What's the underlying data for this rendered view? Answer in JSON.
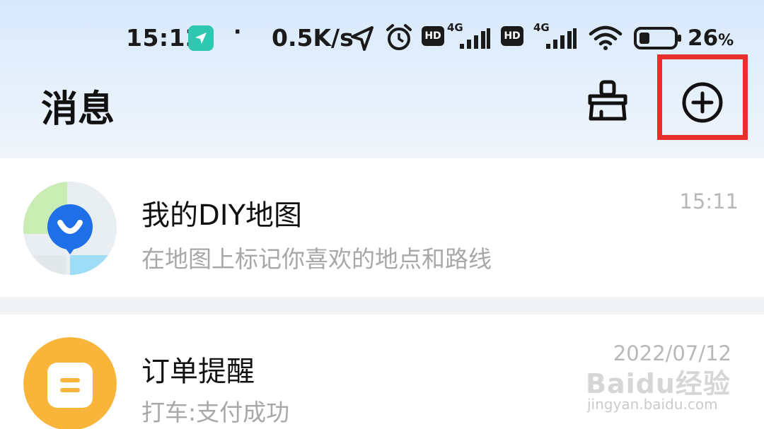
{
  "status_bar": {
    "time": "15:12",
    "dot": "·",
    "net_speed": "0.5K/s",
    "hd_label": "HD",
    "network_label": "4G",
    "battery_value": "26",
    "battery_unit": "%",
    "icons": [
      "navigation-badge-icon",
      "location-arrow-icon",
      "alarm-icon",
      "hd-icon",
      "signal-icon",
      "wifi-icon",
      "battery-icon"
    ]
  },
  "header": {
    "title": "消息",
    "icons": [
      "clean-brush-icon",
      "add-circle-icon"
    ]
  },
  "messages": [
    {
      "title": "我的DIY地图",
      "subtitle": "在地图上标记你喜欢的地点和路线",
      "time": "15:11",
      "avatar_icon": "diy-map-avatar-icon"
    },
    {
      "title": "订单提醒",
      "subtitle": "打车:支付成功",
      "time": "2022/07/12",
      "avatar_icon": "order-avatar-icon"
    }
  ],
  "watermark": {
    "logo": "Baidu经验",
    "url": "jingyan.baidu.com"
  },
  "colors": {
    "highlight": "#e8302a",
    "map_badge": "#1f6fe8",
    "order_avatar": "#f9b43a",
    "nav_badge": "#2ec7b0"
  }
}
